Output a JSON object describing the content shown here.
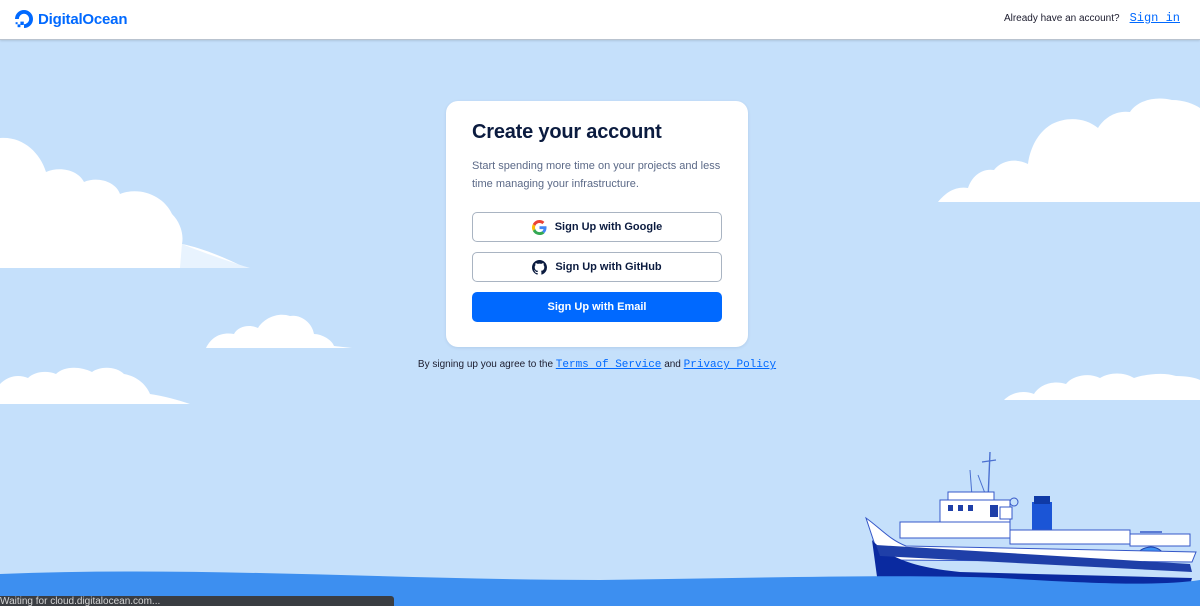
{
  "header": {
    "brand": "DigitalOcean",
    "account_prompt": "Already have an account?",
    "signin_label": "Sign in"
  },
  "card": {
    "title": "Create your account",
    "subtitle": "Start spending more time on your projects and less time managing your infrastructure.",
    "google_label": "Sign Up with Google",
    "github_label": "Sign Up with GitHub",
    "email_label": "Sign Up with Email"
  },
  "terms": {
    "prefix": "By signing up you agree to the",
    "tos_label": "Terms of Service",
    "conjunction": "and",
    "privacy_label": "Privacy Policy"
  },
  "status": {
    "text": "Waiting for cloud.digitalocean.com..."
  },
  "colors": {
    "accent": "#0069ff",
    "sky": "#c5e0fb",
    "sea": "#3d8ff0",
    "title": "#0b1b3f"
  }
}
